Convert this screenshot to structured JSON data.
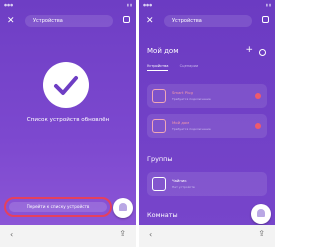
{
  "left_screen": {
    "title": "Устройства",
    "message": "Список устройств обновлён",
    "goto_button": "Перейти к списку устройств"
  },
  "right_screen": {
    "title": "Устройства",
    "home_title": "Мой дом",
    "tabs": [
      {
        "label": "Устройства",
        "active": true
      },
      {
        "label": "Сценарии",
        "active": false
      }
    ],
    "devices": [
      {
        "name": "Smart Plug",
        "sub": "Требуется подключение",
        "status_color": "#ee5a6c"
      },
      {
        "name": "Мой дом",
        "sub": "Требуется подключение",
        "status_color": "#ee5a6c"
      }
    ],
    "groups_title": "Группы",
    "groups": [
      {
        "name": "Чайник",
        "sub": "Нет устройств"
      }
    ],
    "rooms_title": "Комнаты"
  },
  "colors": {
    "accent_purple": "#7545c9",
    "highlight_red": "#e5405e",
    "status_red": "#ee5a6c"
  }
}
